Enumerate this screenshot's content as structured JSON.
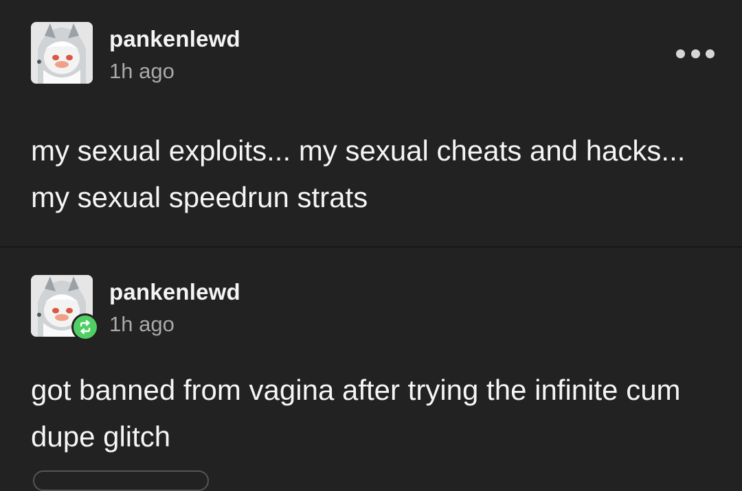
{
  "posts": [
    {
      "username": "pankenlewd",
      "timestamp": "1h ago",
      "avatar_icon": "user-avatar",
      "menu_icon": "more-options-icon",
      "body": "my sexual exploits... my sexual cheats and hacks... my sexual speedrun strats"
    },
    {
      "username": "pankenlewd",
      "timestamp": "1h ago",
      "avatar_icon": "user-avatar",
      "badge_icon": "reblog-icon",
      "body": "got banned from vagina after trying the infinite cum dupe glitch"
    }
  ],
  "colors": {
    "background": "#222222",
    "username": "#f4f4f4",
    "timestamp": "#a9a9a9",
    "body_text": "#f5f5f5",
    "reblog_badge": "#4fcf64"
  }
}
